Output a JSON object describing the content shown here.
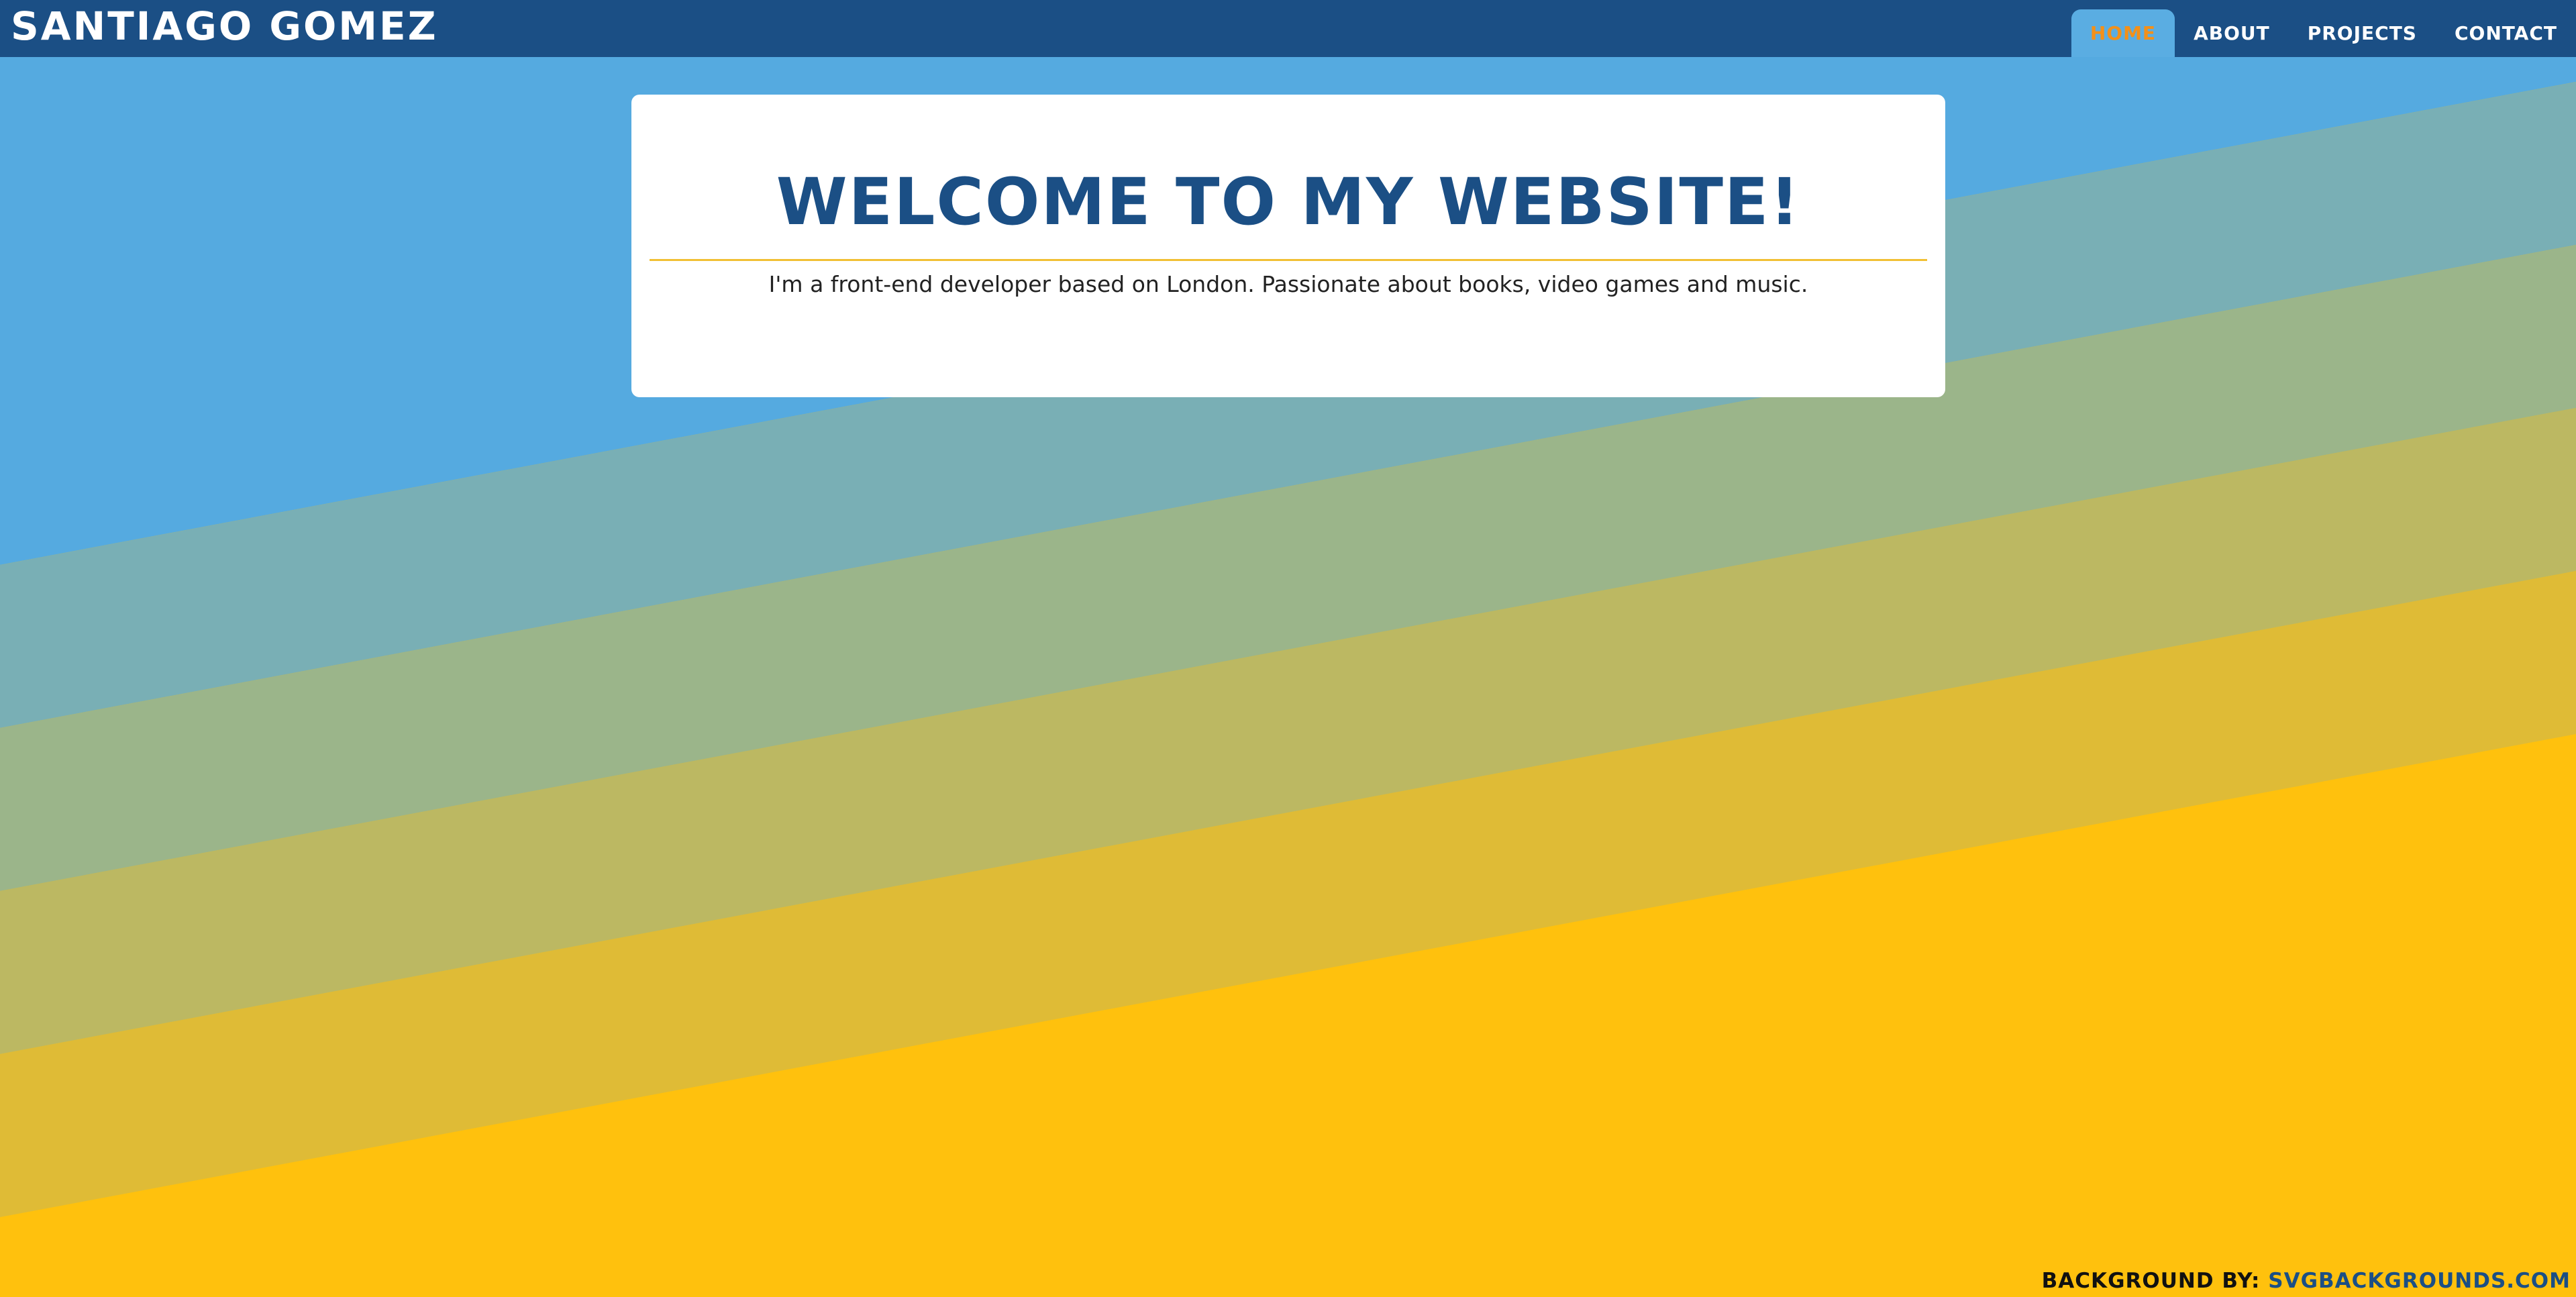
{
  "header": {
    "brand": "Santiago Gomez",
    "nav": [
      {
        "label": "Home",
        "active": true
      },
      {
        "label": "About",
        "active": false
      },
      {
        "label": "Projects",
        "active": false
      },
      {
        "label": "Contact",
        "active": false
      }
    ]
  },
  "hero": {
    "title": "Welcome to my website!",
    "subtitle": "I'm a front-end developer based on London. Passionate about books, video games and music."
  },
  "footer": {
    "credit_label": "Background by:",
    "credit_link": "SVGBackgrounds.com"
  },
  "colors": {
    "header_bg": "#1b4f85",
    "active_tab_bg": "#5aade2",
    "active_tab_text": "#f39019",
    "divider": "#f2c033",
    "background_stripes": [
      "#55aae0",
      "#79afb5",
      "#9bb58a",
      "#bcb862",
      "#dfbb36",
      "#ffc10d"
    ]
  }
}
